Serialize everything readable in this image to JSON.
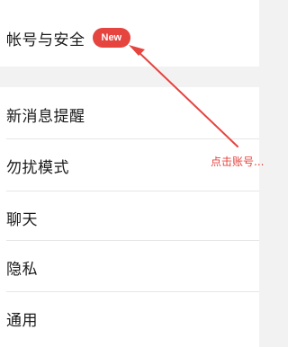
{
  "settings": {
    "items": [
      {
        "label": "帐号与安全",
        "badge": "New"
      },
      {
        "label": "新消息提醒"
      },
      {
        "label": "勿扰模式"
      },
      {
        "label": "聊天"
      },
      {
        "label": "隐私"
      },
      {
        "label": "通用"
      }
    ]
  },
  "annotation": {
    "text": "点击账号...",
    "color": "#e5443f"
  },
  "colors": {
    "background": "#f2f2f2",
    "row": "#ffffff",
    "badge": "#e5443f",
    "divider": "#e6e6e6"
  }
}
